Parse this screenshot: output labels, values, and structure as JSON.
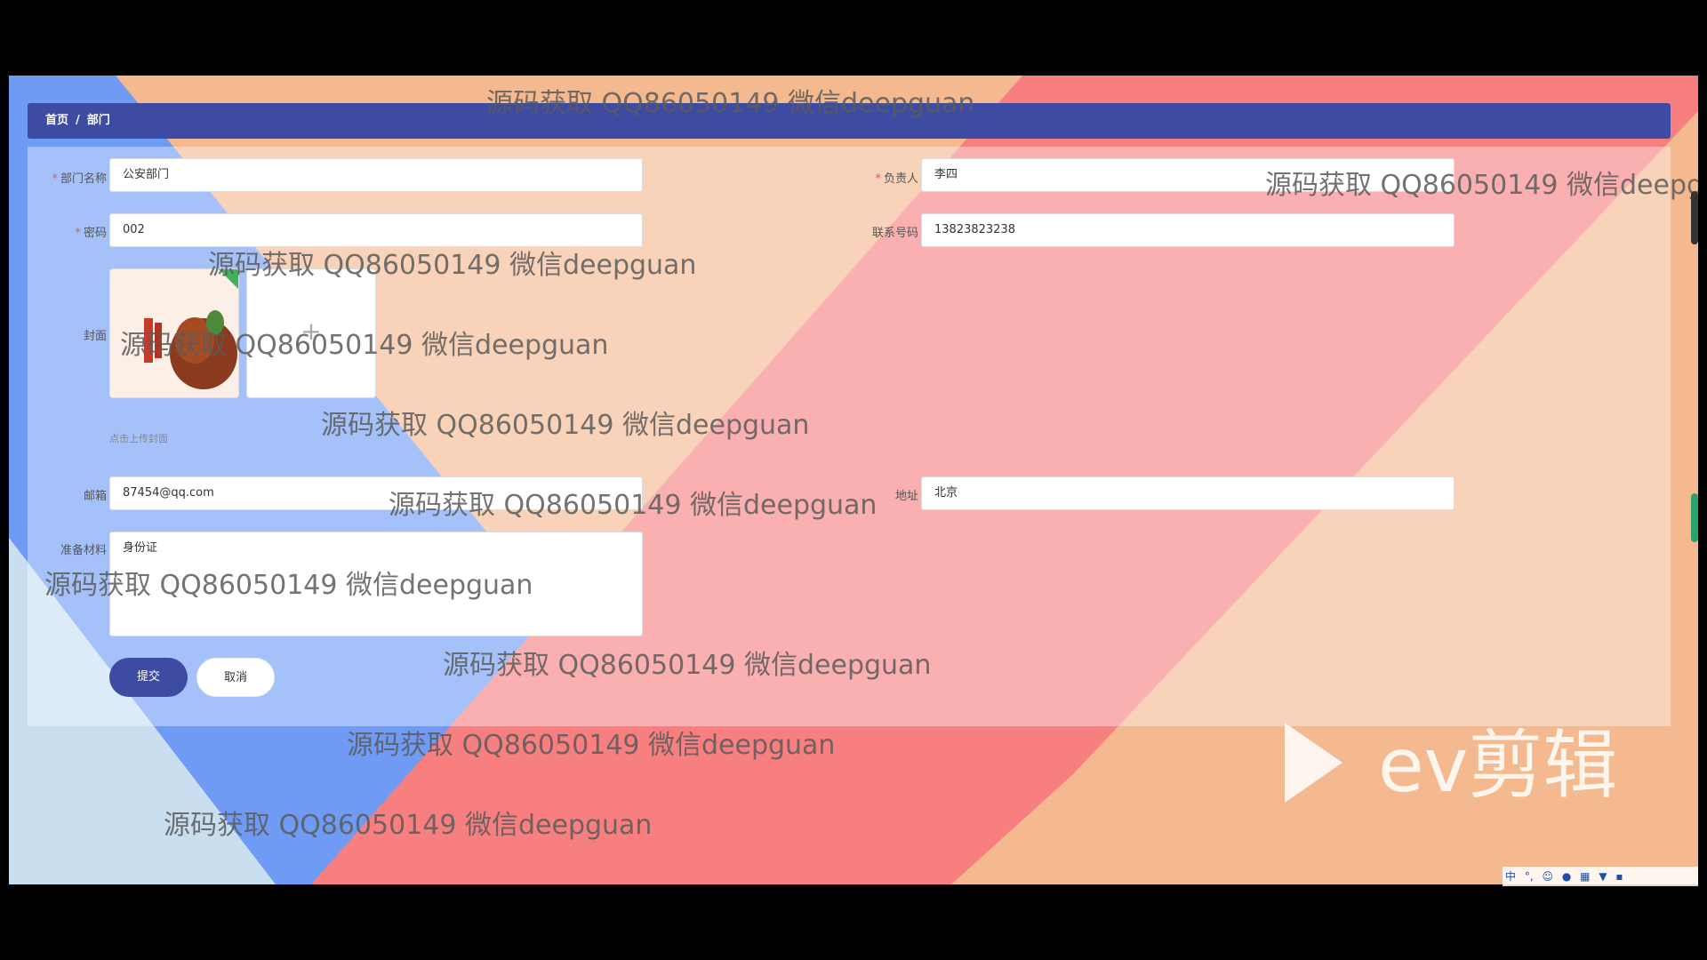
{
  "breadcrumb": {
    "home": "首页",
    "separator": "/",
    "current": "部门"
  },
  "form": {
    "dept_name": {
      "label": "部门名称",
      "required_mark": "*",
      "value": "公安部门"
    },
    "leader": {
      "label": "负责人",
      "required_mark": "*",
      "value": "李四"
    },
    "password": {
      "label": "密码",
      "required_mark": "*",
      "value": "002"
    },
    "phone": {
      "label": "联系号码",
      "value": "13823823238"
    },
    "cover": {
      "label": "封面",
      "hint": "点击上传封面",
      "upload_plus": "+"
    },
    "email": {
      "label": "邮箱",
      "value": "87454@qq.com"
    },
    "address": {
      "label": "地址",
      "value": "北京"
    },
    "materials": {
      "label": "准备材料",
      "value": "身份证"
    },
    "submit_label": "提交",
    "cancel_label": "取消"
  },
  "watermark_text": "源码获取 QQ86050149 微信deepguan",
  "overlay": {
    "ev_brand": "ev剪辑"
  },
  "taskbar": {
    "ime": "中",
    "punct": "°,",
    "icons": [
      "smile-icon",
      "mic-icon",
      "keyboard-icon",
      "shirt-icon",
      "grid-icon"
    ]
  },
  "colors": {
    "accent": "#3e4ba3",
    "required": "#e2516d",
    "bg_blue": "#6f9bf5",
    "bg_pink": "#f77f80",
    "bg_peach": "#f4b98f"
  }
}
